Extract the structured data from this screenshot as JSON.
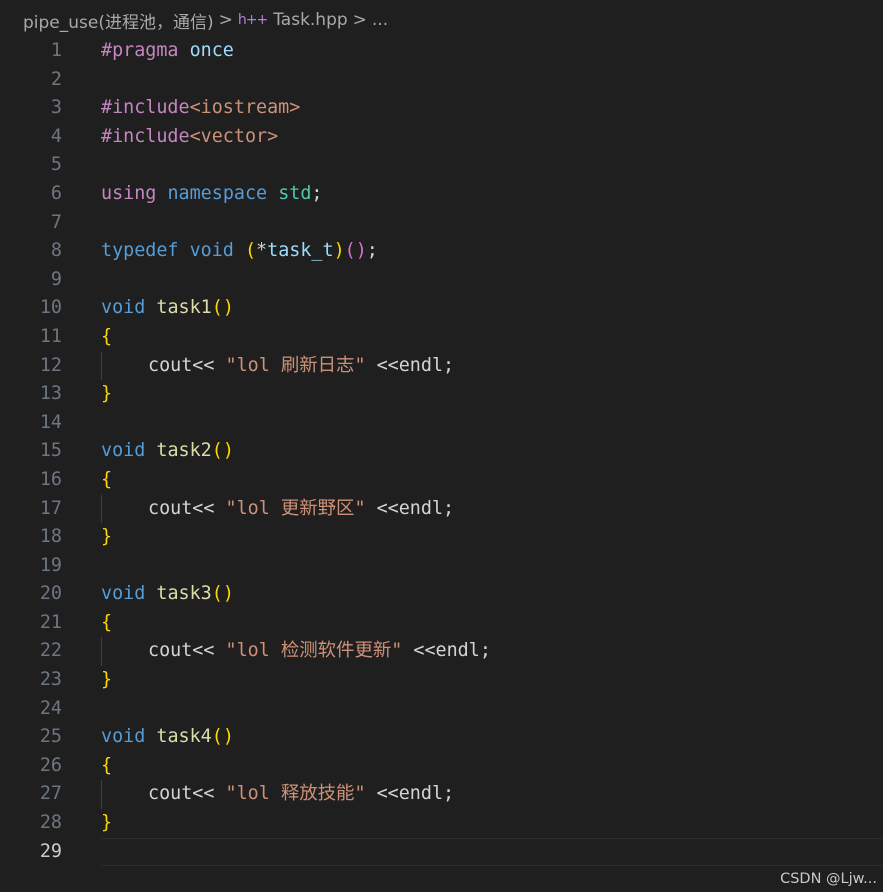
{
  "breadcrumb": {
    "folder": "pipe_use(进程池，通信)",
    "separator": ">",
    "file_icon": "h++",
    "file": "Task.hpp",
    "more": "..."
  },
  "editor": {
    "current_line": 29,
    "lines": [
      {
        "n": "1",
        "tokens": [
          {
            "t": "#pragma",
            "c": "directive"
          },
          {
            "t": " ",
            "c": "plain"
          },
          {
            "t": "once",
            "c": "var"
          }
        ]
      },
      {
        "n": "2",
        "tokens": []
      },
      {
        "n": "3",
        "tokens": [
          {
            "t": "#include",
            "c": "directive"
          },
          {
            "t": "<iostream>",
            "c": "header"
          }
        ]
      },
      {
        "n": "4",
        "tokens": [
          {
            "t": "#include",
            "c": "directive"
          },
          {
            "t": "<vector>",
            "c": "header"
          }
        ]
      },
      {
        "n": "5",
        "tokens": []
      },
      {
        "n": "6",
        "tokens": [
          {
            "t": "using",
            "c": "directive"
          },
          {
            "t": " ",
            "c": "plain"
          },
          {
            "t": "namespace",
            "c": "keyword"
          },
          {
            "t": " ",
            "c": "plain"
          },
          {
            "t": "std",
            "c": "namespace"
          },
          {
            "t": ";",
            "c": "plain"
          }
        ]
      },
      {
        "n": "7",
        "tokens": []
      },
      {
        "n": "8",
        "tokens": [
          {
            "t": "typedef",
            "c": "keyword"
          },
          {
            "t": " ",
            "c": "plain"
          },
          {
            "t": "void",
            "c": "keyword"
          },
          {
            "t": " ",
            "c": "plain"
          },
          {
            "t": "(",
            "c": "brace"
          },
          {
            "t": "*",
            "c": "plain"
          },
          {
            "t": "task_t",
            "c": "var"
          },
          {
            "t": ")",
            "c": "brace"
          },
          {
            "t": "(",
            "c": "paren2"
          },
          {
            "t": ")",
            "c": "paren2"
          },
          {
            "t": ";",
            "c": "plain"
          }
        ]
      },
      {
        "n": "9",
        "tokens": []
      },
      {
        "n": "10",
        "tokens": [
          {
            "t": "void",
            "c": "keyword"
          },
          {
            "t": " ",
            "c": "plain"
          },
          {
            "t": "task1",
            "c": "function"
          },
          {
            "t": "()",
            "c": "brace"
          }
        ]
      },
      {
        "n": "11",
        "tokens": [
          {
            "t": "{",
            "c": "brace"
          }
        ]
      },
      {
        "n": "12",
        "indent": 1,
        "tokens": [
          {
            "t": "cout",
            "c": "plain"
          },
          {
            "t": "<< ",
            "c": "op"
          },
          {
            "t": "\"lol 刷新日志\"",
            "c": "string"
          },
          {
            "t": " <<",
            "c": "op"
          },
          {
            "t": "endl",
            "c": "plain"
          },
          {
            "t": ";",
            "c": "plain"
          }
        ]
      },
      {
        "n": "13",
        "tokens": [
          {
            "t": "}",
            "c": "brace"
          }
        ]
      },
      {
        "n": "14",
        "tokens": []
      },
      {
        "n": "15",
        "tokens": [
          {
            "t": "void",
            "c": "keyword"
          },
          {
            "t": " ",
            "c": "plain"
          },
          {
            "t": "task2",
            "c": "function"
          },
          {
            "t": "()",
            "c": "brace"
          }
        ]
      },
      {
        "n": "16",
        "tokens": [
          {
            "t": "{",
            "c": "brace"
          }
        ]
      },
      {
        "n": "17",
        "indent": 1,
        "tokens": [
          {
            "t": "cout",
            "c": "plain"
          },
          {
            "t": "<< ",
            "c": "op"
          },
          {
            "t": "\"lol 更新野区\"",
            "c": "string"
          },
          {
            "t": " <<",
            "c": "op"
          },
          {
            "t": "endl",
            "c": "plain"
          },
          {
            "t": ";",
            "c": "plain"
          }
        ]
      },
      {
        "n": "18",
        "tokens": [
          {
            "t": "}",
            "c": "brace"
          }
        ]
      },
      {
        "n": "19",
        "tokens": []
      },
      {
        "n": "20",
        "tokens": [
          {
            "t": "void",
            "c": "keyword"
          },
          {
            "t": " ",
            "c": "plain"
          },
          {
            "t": "task3",
            "c": "function"
          },
          {
            "t": "()",
            "c": "brace"
          }
        ]
      },
      {
        "n": "21",
        "tokens": [
          {
            "t": "{",
            "c": "brace"
          }
        ]
      },
      {
        "n": "22",
        "indent": 1,
        "tokens": [
          {
            "t": "cout",
            "c": "plain"
          },
          {
            "t": "<< ",
            "c": "op"
          },
          {
            "t": "\"lol 检测软件更新\"",
            "c": "string"
          },
          {
            "t": " <<",
            "c": "op"
          },
          {
            "t": "endl",
            "c": "plain"
          },
          {
            "t": ";",
            "c": "plain"
          }
        ]
      },
      {
        "n": "23",
        "tokens": [
          {
            "t": "}",
            "c": "brace"
          }
        ]
      },
      {
        "n": "24",
        "tokens": []
      },
      {
        "n": "25",
        "tokens": [
          {
            "t": "void",
            "c": "keyword"
          },
          {
            "t": " ",
            "c": "plain"
          },
          {
            "t": "task4",
            "c": "function"
          },
          {
            "t": "()",
            "c": "brace"
          }
        ]
      },
      {
        "n": "26",
        "tokens": [
          {
            "t": "{",
            "c": "brace"
          }
        ]
      },
      {
        "n": "27",
        "indent": 1,
        "tokens": [
          {
            "t": "cout",
            "c": "plain"
          },
          {
            "t": "<< ",
            "c": "op"
          },
          {
            "t": "\"lol 释放技能\"",
            "c": "string"
          },
          {
            "t": " <<",
            "c": "op"
          },
          {
            "t": "endl",
            "c": "plain"
          },
          {
            "t": ";",
            "c": "plain"
          }
        ]
      },
      {
        "n": "28",
        "tokens": [
          {
            "t": "}",
            "c": "brace"
          }
        ]
      },
      {
        "n": "29",
        "tokens": []
      }
    ]
  },
  "watermark": "CSDN @Ljw...",
  "colors": {
    "background": "#1f1f1f",
    "keyword": "#569cd6",
    "directive": "#c586c0",
    "string": "#ce9178",
    "namespace": "#4ec9b0",
    "function": "#dcdcaa",
    "variable": "#9cdcfe",
    "bracket": "#ffd700"
  }
}
